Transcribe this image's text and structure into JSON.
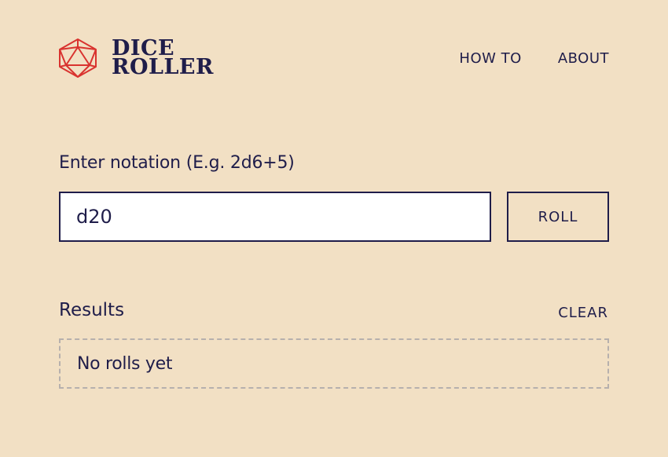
{
  "colors": {
    "background": "#f2e0c4",
    "text": "#1f1d4a",
    "logo_accent": "#d9332f",
    "input_background": "#ffffff",
    "results_border": "#b6b0ad"
  },
  "header": {
    "logo": {
      "icon": "d20-icon",
      "line1": "DICE",
      "line2": "ROLLER"
    },
    "nav": [
      {
        "label": "HOW TO"
      },
      {
        "label": "ABOUT"
      }
    ]
  },
  "notation": {
    "label": "Enter notation (E.g. 2d6+5)",
    "value": "d20",
    "roll_label": "ROLL"
  },
  "results": {
    "title": "Results",
    "clear_label": "CLEAR",
    "empty_text": "No rolls yet"
  }
}
